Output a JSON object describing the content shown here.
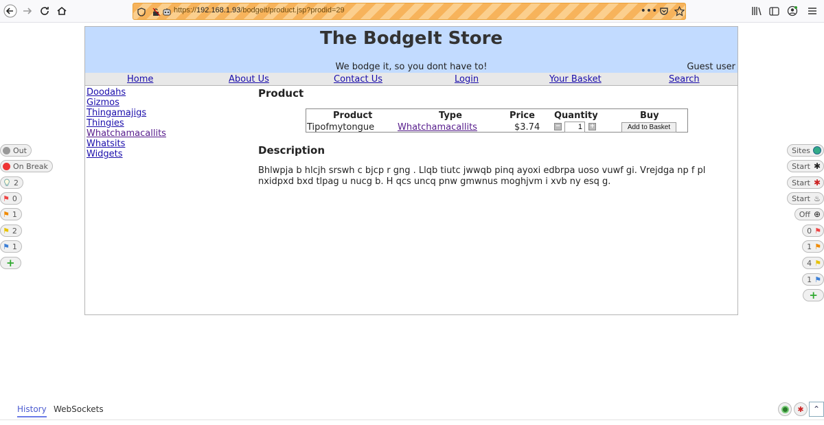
{
  "browser": {
    "url_scheme": "https://",
    "url_host": "192.168.1.93",
    "url_path": "/bodgeit/product.jsp?prodid=29"
  },
  "store": {
    "title": "The BodgeIt Store",
    "tagline": "We bodge it, so you dont have to!",
    "user": "Guest user"
  },
  "nav": [
    "Home",
    "About Us",
    "Contact Us",
    "Login",
    "Your Basket",
    "Search"
  ],
  "categories": [
    "Doodahs",
    "Gizmos",
    "Thingamajigs",
    "Thingies",
    "Whatchamacallits",
    "Whatsits",
    "Widgets"
  ],
  "product_section": {
    "heading": "Product",
    "headers": {
      "product": "Product",
      "type": "Type",
      "price": "Price",
      "quantity": "Quantity",
      "buy": "Buy"
    },
    "row": {
      "name": "Tipofmytongue",
      "type": "Whatchamacallits",
      "price": "$3.74",
      "quantity": "1",
      "button": "Add to Basket"
    }
  },
  "description": {
    "heading": "Description",
    "text": "Bhlwpja b hlcjh srswh c bjcp r gng . Llqb tiutc jwwqb pinq ayoxi edbrpa uoso vuwf gi. Vrejdga np f pl nxidpxd bxd tlpag u nucg b. H qcs uncq pnw gmwnus moghjvm i xvb ny esq g."
  },
  "hud_left": {
    "out": "Out",
    "on_break": "On  Break",
    "alerts_info": "2",
    "alerts_high": "0",
    "alerts_medium": "1",
    "alerts_low": "2",
    "alerts_informational": "1"
  },
  "hud_right": {
    "sites": "Sites",
    "start_spider": "Start",
    "start_ajax": "Start",
    "start_active": "Start",
    "attack_mode": "Off",
    "alerts_high": "0",
    "alerts_medium": "1",
    "alerts_low": "4",
    "alerts_informational": "1"
  },
  "bottom_tabs": [
    "History",
    "WebSockets"
  ]
}
